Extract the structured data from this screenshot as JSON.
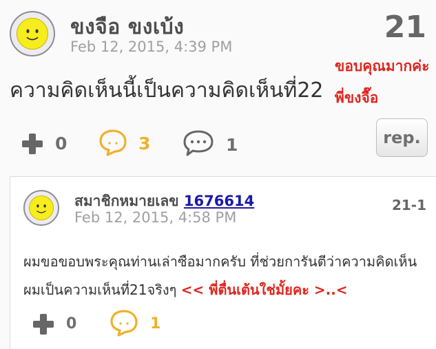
{
  "comment": {
    "author": "ขงจือ ขงเบ้ง",
    "date": "Feb 12, 2015, 4:39 PM",
    "number": "21",
    "body": "ความคิดเห็นนี้เป็นความคิดเห็นที่22",
    "annotation_line1": "ขอบคุณมากค่ะ",
    "annotation_line2": "พี่ขงจื๊อ",
    "plus_count": "0",
    "emotion_count": "3",
    "reply_count": "1",
    "reply_button_label": "rep."
  },
  "reply": {
    "member_prefix": "สมาชิกหมายเลข",
    "member_id": "1676614",
    "date": "Feb 12, 2015, 4:58 PM",
    "number": "21-1",
    "body_main": "ผมขอขอบพระคุณท่านเล่าซือมากครับ ที่ช่วยการันตีว่าความคิดเห็นผมเป็นความเห็นที่21จริงๆ",
    "body_highlight": "<< พี่ตื่นเต้นใช่มั้ยคะ >..<",
    "plus_count": "0",
    "emotion_count": "1"
  },
  "colors": {
    "background": "#fafafa",
    "accent_gold": "#f0b02c",
    "annotation_red": "#e0261f",
    "link_blue": "#1a1aa8",
    "icon_gray": "#666666"
  },
  "icons": [
    "smiley-avatar",
    "plus-icon",
    "emotion-icon",
    "speech-bubble-icon"
  ]
}
